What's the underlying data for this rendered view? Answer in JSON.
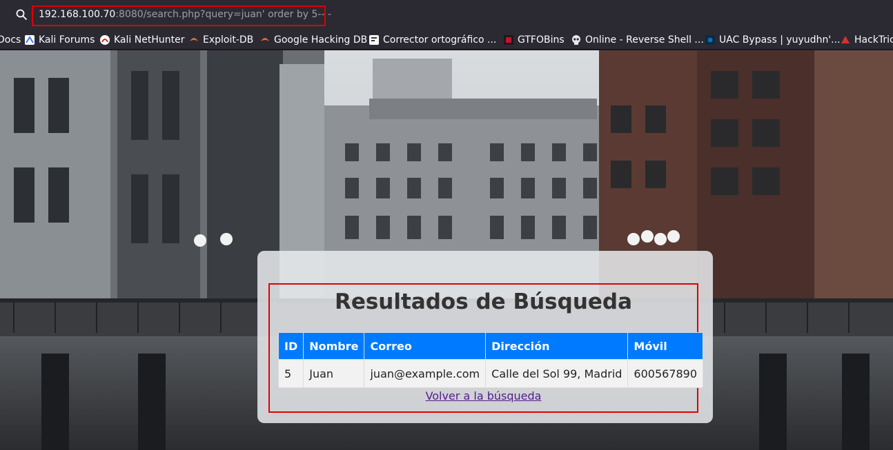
{
  "browser": {
    "url_host": "192.168.100.70",
    "url_rest": ":8080/search.php?query=juan' order by 5-- -"
  },
  "bookmarks": [
    {
      "label": "Docs",
      "icon": "docs-icon"
    },
    {
      "label": "Kali Forums",
      "icon": "kali-forums-icon",
      "color": "#367bf0"
    },
    {
      "label": "Kali NetHunter",
      "icon": "nethunter-icon",
      "color": "#e2202b"
    },
    {
      "label": "Exploit-DB",
      "icon": "exploit-db-icon",
      "color": "#f26722"
    },
    {
      "label": "Google Hacking DB",
      "icon": "ghdb-icon",
      "color": "#f26722"
    },
    {
      "label": "Corrector ortográfico ...",
      "icon": "corrector-icon"
    },
    {
      "label": "GTFOBins",
      "icon": "gtfobins-icon",
      "color": "#c8102e"
    },
    {
      "label": "Online - Reverse Shell ...",
      "icon": "skull-icon"
    },
    {
      "label": "UAC Bypass | yuyudhn'...",
      "icon": "uac-icon",
      "color": "#0b6fb8"
    },
    {
      "label": "HackTricks",
      "icon": "hacktricks-icon",
      "color": "#d9302c"
    }
  ],
  "results": {
    "title": "Resultados de Búsqueda",
    "columns": [
      "ID",
      "Nombre",
      "Correo",
      "Dirección",
      "Móvil"
    ],
    "rows": [
      [
        "5",
        "Juan",
        "juan@example.com",
        "Calle del Sol 99, Madrid",
        "600567890"
      ]
    ],
    "back_link": "Volver a la búsqueda"
  },
  "colors": {
    "accent": "#007bff",
    "highlight": "#e00000",
    "link": "#551a8b"
  }
}
